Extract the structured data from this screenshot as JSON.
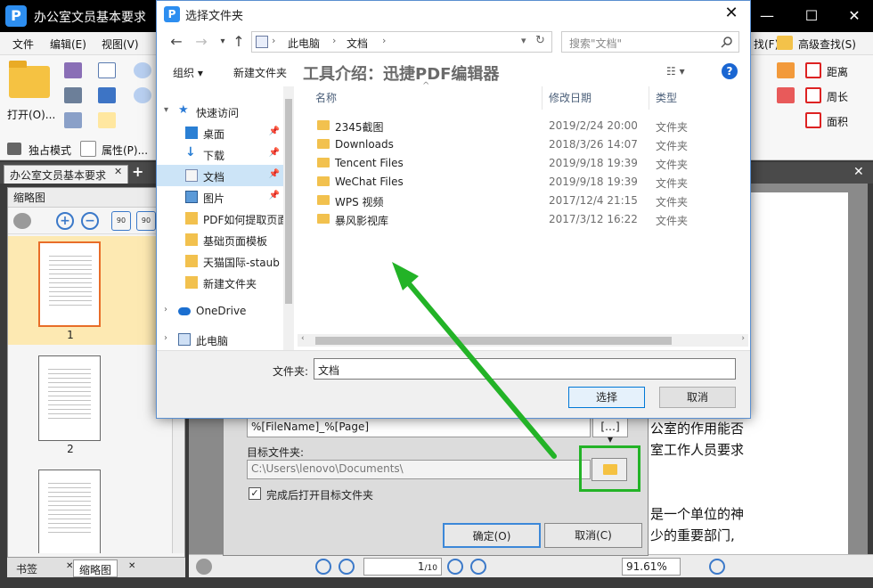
{
  "app": {
    "title": "办公室文员基本要求",
    "logo_letter": "P",
    "menus": [
      "文件",
      "编辑(E)",
      "视图(V)"
    ],
    "menu_right": [
      "找(F)",
      "高级查找(S)"
    ],
    "ribbon": {
      "open_label": "打开(O)...",
      "exclusive_mode": "独占模式",
      "properties": "属性(P)...",
      "measure": [
        "距离",
        "周长",
        "面积"
      ]
    },
    "doc_tab": "办公室文员基本要求",
    "thumbnail_panel": {
      "title": "缩略图",
      "rotate_left": "90",
      "rotate_right": "90",
      "pages": [
        "1",
        "2"
      ]
    },
    "bottom_tabs": [
      "书签",
      "缩略图"
    ],
    "status": {
      "page_current": "1",
      "page_total": "/10",
      "zoom": "91.61%"
    },
    "doc_lines": [
      "公室的作用能否",
      "室工作人员要求",
      "是一个单位的神",
      "少的重要部门,"
    ]
  },
  "export_dialog": {
    "filename_pattern": "%[FileName]_%[Page]",
    "target_label": "目标文件夹:",
    "target_path": "C:\\Users\\lenovo\\Documents\\",
    "open_after": "完成后打开目标文件夹",
    "open_after_checked": "✓",
    "ok": "确定(O)",
    "cancel": "取消(C)"
  },
  "folder_dialog": {
    "title": "选择文件夹",
    "address": [
      "此电脑",
      "文档"
    ],
    "search_placeholder": "搜索\"文档\"",
    "organize": "组织 ▾",
    "new_folder": "新建文件夹",
    "overlay_title": "工具介绍：迅捷PDF编辑器",
    "help": "?",
    "nav": [
      {
        "label": "快速访问",
        "type": "quick"
      },
      {
        "label": "桌面",
        "type": "desktop",
        "pinned": true
      },
      {
        "label": "下载",
        "type": "download",
        "pinned": true
      },
      {
        "label": "文档",
        "type": "documents",
        "pinned": true,
        "selected": true
      },
      {
        "label": "图片",
        "type": "pictures",
        "pinned": true
      },
      {
        "label": "PDF如何提取页面",
        "type": "folder"
      },
      {
        "label": "基础页面模板",
        "type": "folder"
      },
      {
        "label": "天猫国际-staub",
        "type": "folder"
      },
      {
        "label": "新建文件夹",
        "type": "folder"
      },
      {
        "label": "OneDrive",
        "type": "onedrive"
      },
      {
        "label": "此电脑",
        "type": "pc"
      }
    ],
    "columns": [
      "名称",
      "修改日期",
      "类型"
    ],
    "files": [
      {
        "name": "2345截图",
        "date": "2019/2/24 20:00",
        "type": "文件夹"
      },
      {
        "name": "Downloads",
        "date": "2018/3/26 14:07",
        "type": "文件夹"
      },
      {
        "name": "Tencent Files",
        "date": "2019/9/18 19:39",
        "type": "文件夹"
      },
      {
        "name": "WeChat Files",
        "date": "2019/9/18 19:39",
        "type": "文件夹"
      },
      {
        "name": "WPS 视频",
        "date": "2017/12/4 21:15",
        "type": "文件夹"
      },
      {
        "name": "暴风影视库",
        "date": "2017/3/12 16:22",
        "type": "文件夹"
      }
    ],
    "folder_label": "文件夹:",
    "folder_value": "文档",
    "select_button": "选择",
    "cancel_button": "取消"
  },
  "colors": {
    "accent": "#0078d7",
    "highlight_box": "#23b327",
    "selection": "#cce4f7"
  }
}
